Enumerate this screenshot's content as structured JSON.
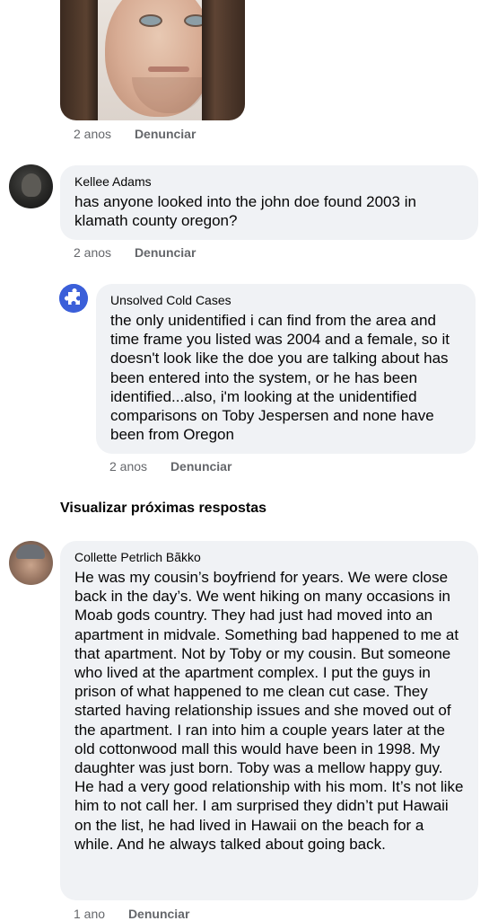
{
  "comments": [
    {
      "time": "2 anos",
      "report": "Denunciar"
    },
    {
      "author": "Kellee Adams",
      "text": "has anyone looked into the john doe found 2003 in klamath county oregon?",
      "time": "2 anos",
      "report": "Denunciar"
    },
    {
      "author": "Unsolved Cold Cases",
      "text": "the only unidentified i can find from the area and time frame you listed was 2004 and a female, so it doesn't look like the doe you are talking about has been entered into the system, or he has been identified...also, i'm looking at the unidentified comparisons on Toby Jespersen and none have been from Oregon",
      "time": "2 anos",
      "report": "Denunciar"
    },
    {
      "author": "Collette Petrlich Bãkko",
      "text": "He was my cousin’s boyfriend for years. We were close back in the day’s. We went hiking on many occasions in Moab gods country. They had just had moved into an apartment in midvale. Something bad happened to me at that apartment. Not by Toby or my cousin. But someone who lived at the apartment complex. I put the guys in prison of what happened to me clean cut case. They started having relationship issues and she moved out of the apartment. I ran into him a couple years later at the old cottonwood mall this would have been in 1998. My daughter was just born. Toby was a mellow happy guy. He had a very good relationship with his mom. It’s not like him to not call her. I am surprised they didn’t put Hawaii on the list, he had lived in Hawaii on the beach for a while. And he always talked about going back.",
      "time": "1 ano",
      "report": "Denunciar"
    }
  ],
  "view_more_replies": "Visualizar próximas respostas",
  "icons": {
    "unsolved_avatar": "puzzle-icon"
  },
  "colors": {
    "bubble_bg": "#f0f2f5",
    "meta_text": "#65676b",
    "cold_cases_avatar": "#3b5fd9"
  }
}
